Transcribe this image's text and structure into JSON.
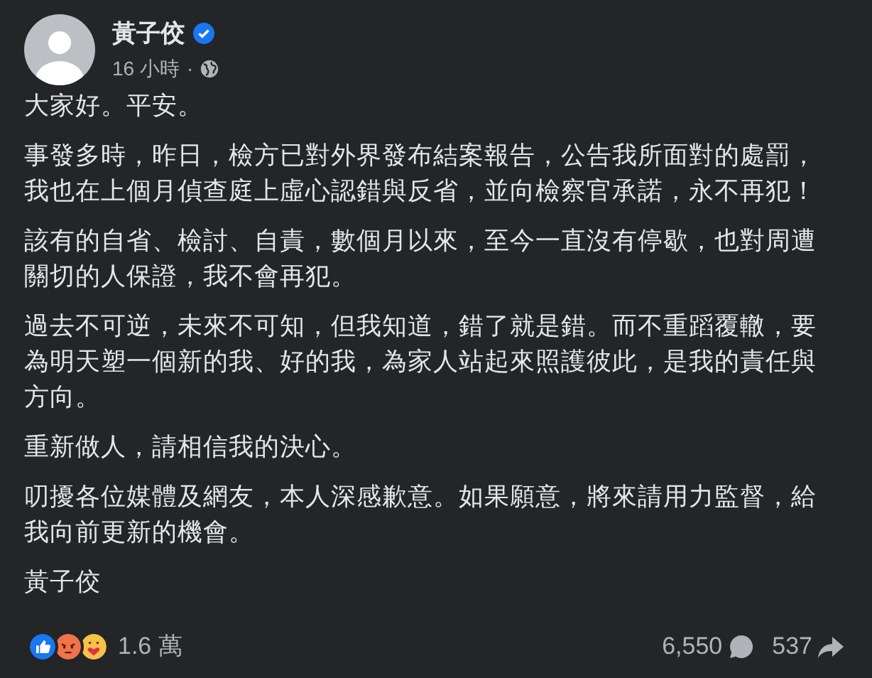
{
  "author": {
    "name": "黃子佼",
    "verified": true,
    "time": "16 小時",
    "separator": "·"
  },
  "paragraphs": [
    [
      "大家好。平安。"
    ],
    [
      "事發多時，昨日，檢方已對外界發布結案報告，公告我所面對的處罰，",
      "我也在上個月偵查庭上虛心認錯與反省，並向檢察官承諾，永不再犯！"
    ],
    [
      "該有的自省、檢討、自責，數個月以來，至今一直沒有停歇，也對周遭",
      "關切的人保證，我不會再犯。"
    ],
    [
      "過去不可逆，未來不可知，但我知道，錯了就是錯。而不重蹈覆轍，要",
      "為明天塑一個新的我、好的我，為家人站起來照護彼此，是我的責任與",
      "方向。"
    ],
    [
      "重新做人，請相信我的決心。"
    ],
    [
      "叨擾各位媒體及網友，本人深感歉意。如果願意，將來請用力監督，給",
      "我向前更新的機會。"
    ],
    [
      "黃子佼"
    ]
  ],
  "footer": {
    "reactions": [
      {
        "kind": "like"
      },
      {
        "kind": "angry"
      },
      {
        "kind": "care"
      }
    ],
    "reaction_count": "1.6 萬",
    "comments": "6,550",
    "shares": "537"
  }
}
